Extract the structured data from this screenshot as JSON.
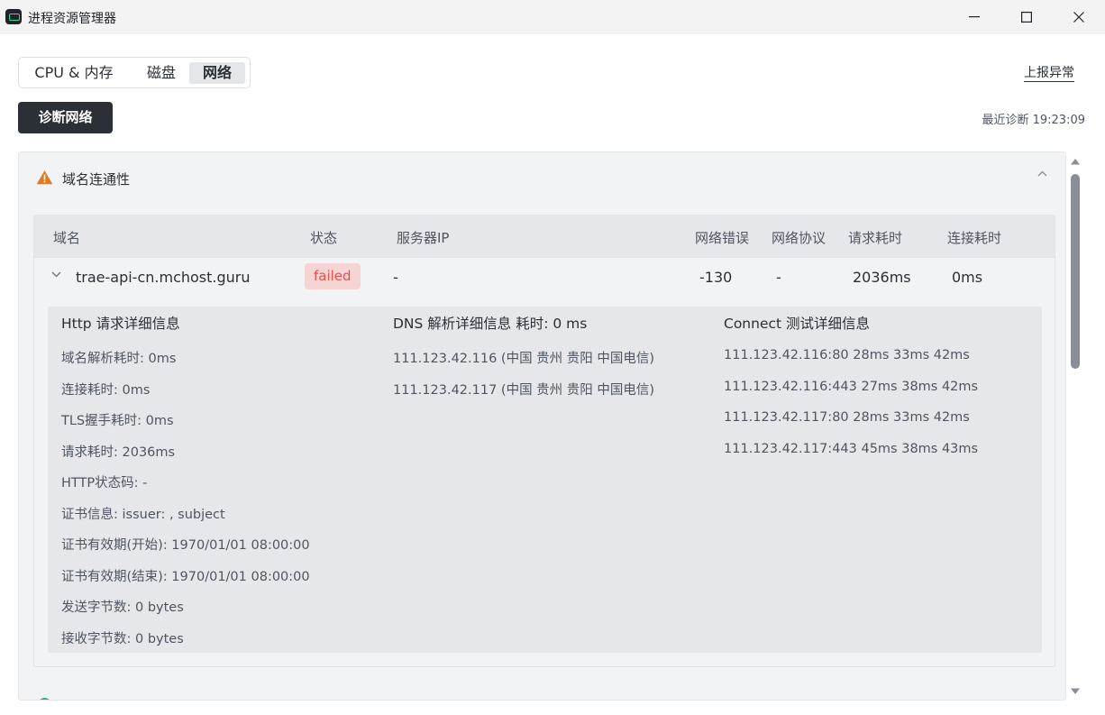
{
  "window": {
    "title": "进程资源管理器",
    "controls": {
      "minimize": "minimize-icon",
      "maximize": "maximize-icon",
      "close": "close-icon"
    }
  },
  "tabs": [
    {
      "label": "CPU & 内存",
      "active": false
    },
    {
      "label": "磁盘",
      "active": false
    },
    {
      "label": "网络",
      "active": true
    }
  ],
  "report_link": "上报异常",
  "diagnose_button": "诊断网络",
  "last_diagnosis": "最近诊断 19:23:09",
  "section": {
    "title": "域名连通性",
    "status_icon": "warning-icon",
    "status_color": "#e07b24"
  },
  "table": {
    "headers": [
      "域名",
      "状态",
      "服务器IP",
      "网络错误",
      "网络协议",
      "请求耗时",
      "连接耗时"
    ],
    "rows": [
      {
        "domain": "trae-api-cn.mchost.guru",
        "status": "failed",
        "server_ip": "-",
        "network_error": "-130",
        "protocol": "-",
        "request_time": "2036ms",
        "connect_time": "0ms"
      }
    ]
  },
  "detail": {
    "http": {
      "title": "Http 请求详细信息",
      "lines": [
        "域名解析耗时: 0ms",
        "连接耗时: 0ms",
        "TLS握手耗时: 0ms",
        "请求耗时: 2036ms",
        "HTTP状态码: -",
        "证书信息: issuer: , subject",
        "证书有效期(开始): 1970/01/01 08:00:00",
        "证书有效期(结束): 1970/01/01 08:00:00",
        "发送字节数: 0 bytes",
        "接收字节数: 0 bytes"
      ]
    },
    "dns": {
      "title": "DNS 解析详细信息 耗时: 0 ms",
      "lines": [
        "111.123.42.116 (中国 贵州 贵阳 中国电信)",
        "111.123.42.117 (中国 贵州 贵阳 中国电信)"
      ]
    },
    "connect": {
      "title": "Connect 测试详细信息",
      "lines": [
        "111.123.42.116:80 28ms 33ms 42ms",
        "111.123.42.116:443 27ms 38ms 42ms",
        "111.123.42.117:80 28ms 33ms 42ms",
        "111.123.42.117:443 45ms 38ms 43ms"
      ]
    }
  },
  "colors": {
    "failed_badge_bg": "#f7d4d4",
    "failed_badge_text": "#e0524f",
    "primary_button": "#2b2f36"
  }
}
